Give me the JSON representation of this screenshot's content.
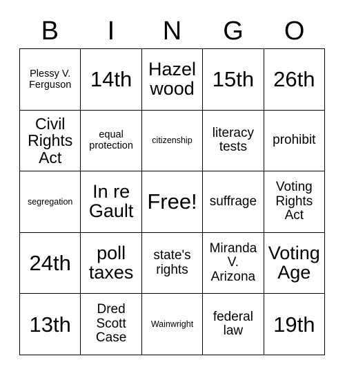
{
  "card": {
    "title": "BINGO",
    "headers": [
      "B",
      "I",
      "N",
      "G",
      "O"
    ],
    "rows": [
      [
        {
          "text": "Plessy V. Ferguson",
          "size": "sm"
        },
        {
          "text": "14th",
          "size": "xxl"
        },
        {
          "text": "Hazelwood",
          "size": "xl"
        },
        {
          "text": "15th",
          "size": "xxl"
        },
        {
          "text": "26th",
          "size": "xxl"
        }
      ],
      [
        {
          "text": "Civil Rights Act",
          "size": "lg"
        },
        {
          "text": "equal protection",
          "size": "sm"
        },
        {
          "text": "citizenship",
          "size": "xs"
        },
        {
          "text": "literacy tests",
          "size": "md"
        },
        {
          "text": "prohibit",
          "size": "md"
        }
      ],
      [
        {
          "text": "segregation",
          "size": "xs"
        },
        {
          "text": "In re Gault",
          "size": "xl"
        },
        {
          "text": "Free!",
          "size": "xxl"
        },
        {
          "text": "suffrage",
          "size": "md"
        },
        {
          "text": "Voting Rights Act",
          "size": "md"
        }
      ],
      [
        {
          "text": "24th",
          "size": "xxl"
        },
        {
          "text": "poll taxes",
          "size": "xl"
        },
        {
          "text": "state's rights",
          "size": "md"
        },
        {
          "text": "Miranda V. Arizona",
          "size": "md"
        },
        {
          "text": "Voting Age",
          "size": "xl"
        }
      ],
      [
        {
          "text": "13th",
          "size": "xxl"
        },
        {
          "text": "Dred Scott Case",
          "size": "md"
        },
        {
          "text": "Wainwright",
          "size": "xs"
        },
        {
          "text": "federal law",
          "size": "md"
        },
        {
          "text": "19th",
          "size": "xxl"
        }
      ]
    ],
    "colors": {
      "border": "#000000",
      "background": "#ffffff",
      "text": "#000000"
    }
  }
}
